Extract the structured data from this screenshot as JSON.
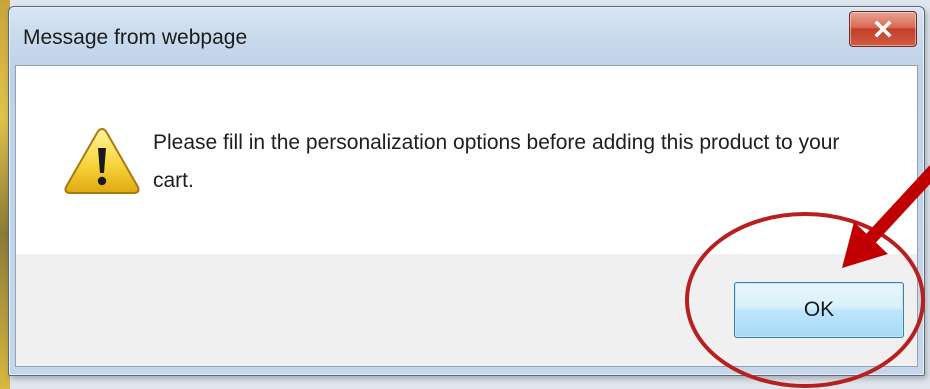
{
  "dialog": {
    "title": "Message from webpage",
    "message": "Please fill in the personalization options before adding this product to your cart.",
    "ok_label": "OK"
  },
  "icons": {
    "message_icon": "warning-icon",
    "close_icon": "close-icon"
  },
  "colors": {
    "annotation": "#c00000",
    "close_button": "#c2402a",
    "ok_button_border": "#3c7fb1"
  }
}
